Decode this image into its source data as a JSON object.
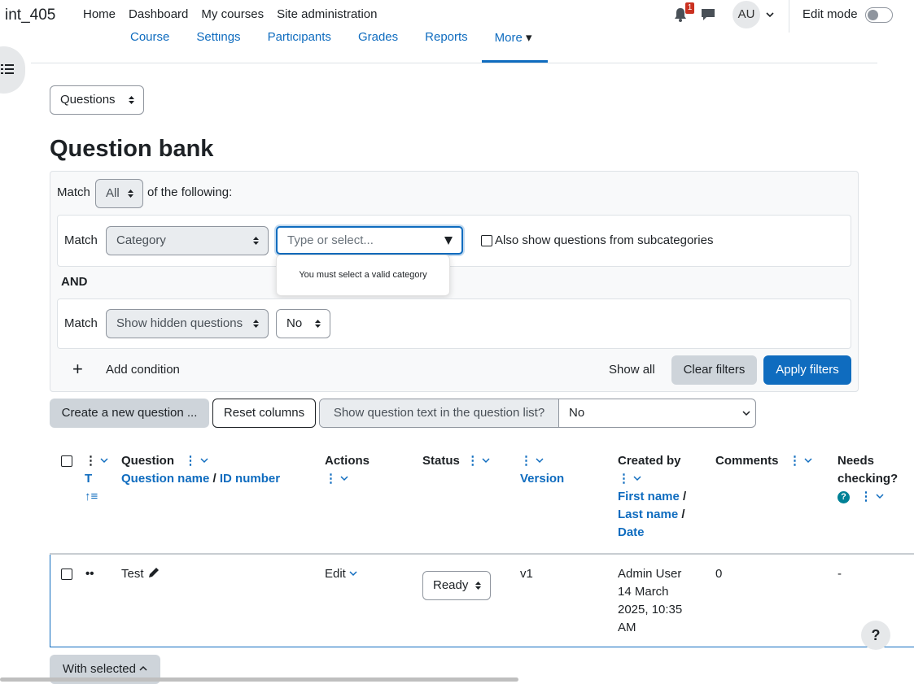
{
  "navbar": {
    "site_name": "int_405",
    "items": [
      "Home",
      "Dashboard",
      "My courses",
      "Site administration"
    ],
    "notification_count": "1",
    "avatar_initials": "AU",
    "edit_mode_label": "Edit mode"
  },
  "secondary_nav": {
    "items": [
      "Course",
      "Settings",
      "Participants",
      "Grades",
      "Reports"
    ],
    "more_label": "More"
  },
  "questions_select": "Questions",
  "page_title": "Question bank",
  "filters": {
    "match_label": "Match",
    "match_value": "All",
    "of_following": "of the following:",
    "cond1_match": "Match",
    "cond1_field": "Category",
    "cond1_placeholder": "Type or select...",
    "cond1_error": "You must select a valid category",
    "subcategories_label": "Also show questions from subcategories",
    "and_label": "AND",
    "cond2_match": "Match",
    "cond2_field": "Show hidden questions",
    "cond2_value": "No",
    "add_condition_plus": "+",
    "add_condition": "Add condition",
    "show_all": "Show all",
    "clear_filters": "Clear filters",
    "apply_filters": "Apply filters"
  },
  "toolbar": {
    "create_new": "Create a new question ...",
    "reset_columns": "Reset columns",
    "show_text_label": "Show question text in the question list?",
    "show_text_value": "No"
  },
  "table": {
    "headers": {
      "type_sort_t": "T",
      "question": "Question",
      "question_name": "Question name",
      "slash": "/",
      "id_number": "ID number",
      "actions": "Actions",
      "status": "Status",
      "version": "Version",
      "created_by": "Created by",
      "first_name": "First name",
      "last_name": "Last name",
      "date": "Date",
      "comments": "Comments",
      "needs_checking": "Needs checking?",
      "help_q": "?"
    },
    "row": {
      "name": "Test",
      "edit": "Edit",
      "status": "Ready",
      "version": "v1",
      "creator": "Admin User",
      "date_line1": "14 March",
      "date_line2": "2025, 10:35",
      "date_line3": "AM",
      "comments": "0",
      "needs_checking": "-"
    }
  },
  "with_selected": "With selected",
  "help_button": "?",
  "colors": {
    "primary": "#0f6cbf",
    "secondary_btn": "#ced4da",
    "notification": "#ca3120",
    "help_icon": "#008196"
  }
}
